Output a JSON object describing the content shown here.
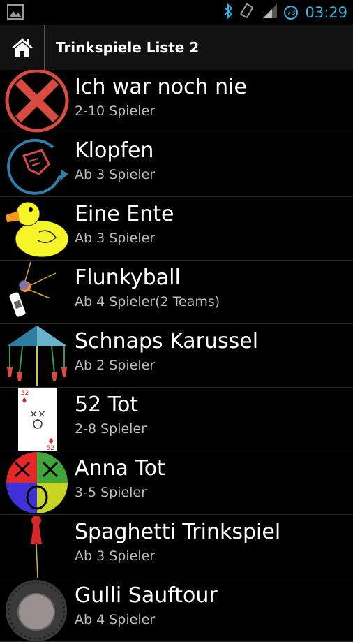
{
  "statusbar": {
    "time": "03:29",
    "battery_level": "73",
    "icons": [
      "image-icon",
      "bluetooth-icon",
      "rotation-icon",
      "signal-icon",
      "battery-icon"
    ]
  },
  "actionbar": {
    "home_icon": "home-icon",
    "title": "Trinkspiele Liste 2"
  },
  "games": [
    {
      "name": "Ich war noch nie",
      "players": "2-10 Spieler",
      "icon": "red-x-circle-icon"
    },
    {
      "name": "Klopfen",
      "players": "Ab 3 Spieler",
      "icon": "knock-hand-icon"
    },
    {
      "name": "Eine Ente",
      "players": "Ab 3 Spieler",
      "icon": "duck-icon"
    },
    {
      "name": "Flunkyball",
      "players": "Ab 4 Spieler(2 Teams)",
      "icon": "ball-bottle-icon"
    },
    {
      "name": "Schnaps Karussel",
      "players": "Ab 2 Spieler",
      "icon": "carousel-icon"
    },
    {
      "name": "52 Tot",
      "players": "2-8 Spieler",
      "icon": "playing-card-icon"
    },
    {
      "name": "Anna Tot",
      "players": "3-5 Spieler",
      "icon": "color-circle-icon"
    },
    {
      "name": "Spaghetti Trinkspiel",
      "players": "Ab 3 Spieler",
      "icon": "game-pawn-icon"
    },
    {
      "name": "Gulli Sauftour",
      "players": "Ab 4 Spieler",
      "icon": "manhole-icon"
    }
  ],
  "card": {
    "rank": "52",
    "suit": "♦",
    "face": "××"
  },
  "colors": {
    "accent": "#33b5e5",
    "background": "#000000",
    "actionbar": "#121212"
  }
}
